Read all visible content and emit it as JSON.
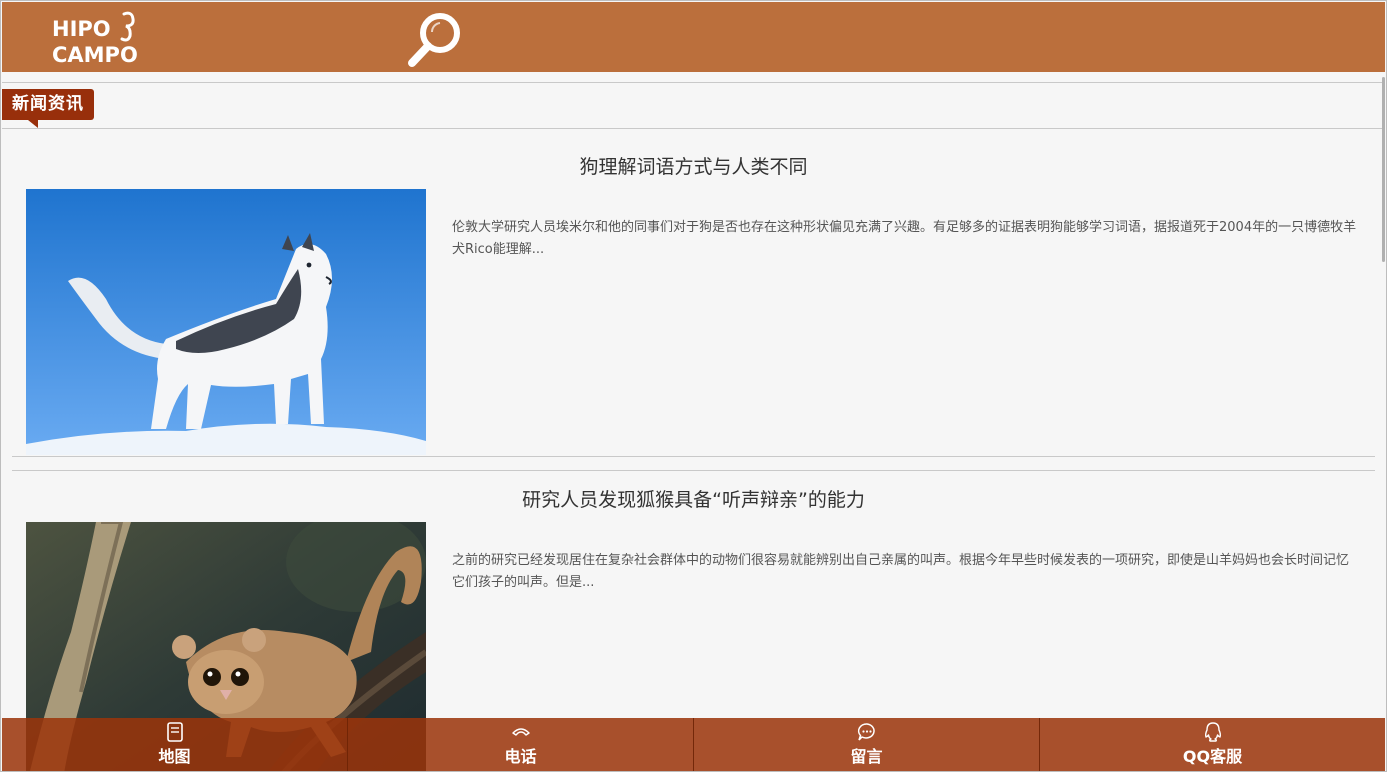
{
  "header": {
    "logo_line1": "HIPO",
    "logo_line2": "CAMPO",
    "background": "#bb6f3c"
  },
  "section": {
    "label": "新闻资讯",
    "color": "#982f0b"
  },
  "news": [
    {
      "title": "狗理解词语方式与人类不同",
      "excerpt": "伦敦大学研究人员埃米尔和他的同事们对于狗是否也存在这种形状偏见充满了兴趣。有足够多的证据表明狗能够学习词语，据报道死于2004年的一只博德牧羊犬Rico能理解..."
    },
    {
      "title": "研究人员发现狐猴具备“听声辩亲”的能力",
      "excerpt": "之前的研究已经发现居住在复杂社会群体中的动物们很容易就能辨别出自己亲属的叫声。根据今年早些时候发表的一项研究，即使是山羊妈妈也会长时间记忆它们孩子的叫声。但是..."
    }
  ],
  "bottom_nav": {
    "items": [
      {
        "label": "地图",
        "icon": "map-icon"
      },
      {
        "label": "电话",
        "icon": "phone-icon"
      },
      {
        "label": "留言",
        "icon": "message-icon"
      },
      {
        "label": "QQ客服",
        "icon": "qq-icon"
      }
    ],
    "background": "#9b340a"
  }
}
